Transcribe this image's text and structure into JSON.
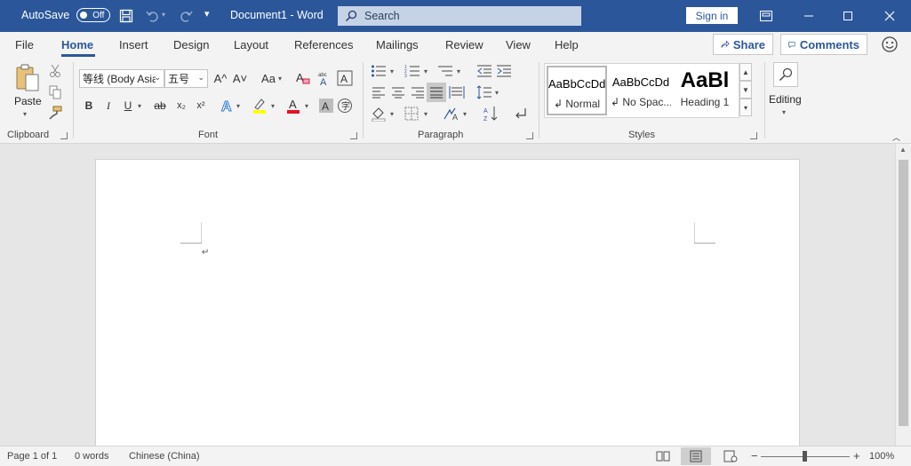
{
  "titlebar": {
    "autosave_label": "AutoSave",
    "autosave_state": "Off",
    "document_name": "Document1",
    "separator": "-",
    "app_name": "Word",
    "search_placeholder": "Search",
    "signin_label": "Sign in"
  },
  "tabs": [
    "File",
    "Home",
    "Insert",
    "Design",
    "Layout",
    "References",
    "Mailings",
    "Review",
    "View",
    "Help"
  ],
  "active_tab": "Home",
  "share_label": "Share",
  "comments_label": "Comments",
  "ribbon": {
    "clipboard": {
      "paste_label": "Paste",
      "group_label": "Clipboard"
    },
    "font": {
      "font_name": "等线 (Body Asia",
      "font_size": "五号",
      "group_label": "Font",
      "grow": "A^",
      "shrink": "A˅",
      "case": "Aa",
      "bold": "B",
      "italic": "I",
      "underline": "U",
      "strike": "ab",
      "subscript": "x₂",
      "superscript": "x²",
      "highlight_color": "#ffff00",
      "font_color": "#e81123"
    },
    "paragraph": {
      "group_label": "Paragraph"
    },
    "styles": {
      "group_label": "Styles",
      "items": [
        {
          "sample": "AaBbCcDd",
          "name": "↲ Normal"
        },
        {
          "sample": "AaBbCcDd",
          "name": "↲ No Spac..."
        },
        {
          "sample": "AaBl",
          "name": "Heading 1"
        }
      ]
    },
    "editing": {
      "label": "Editing"
    }
  },
  "document": {
    "paragraph_mark": "↵"
  },
  "statusbar": {
    "page": "Page 1 of 1",
    "words": "0 words",
    "language": "Chinese (China)",
    "zoom": "100%",
    "zoom_minus": "−",
    "zoom_plus": "+"
  },
  "colors": {
    "accent": "#2b579a",
    "ribbon_bg": "#f3f3f3",
    "canvas_bg": "#e6e6e6"
  }
}
